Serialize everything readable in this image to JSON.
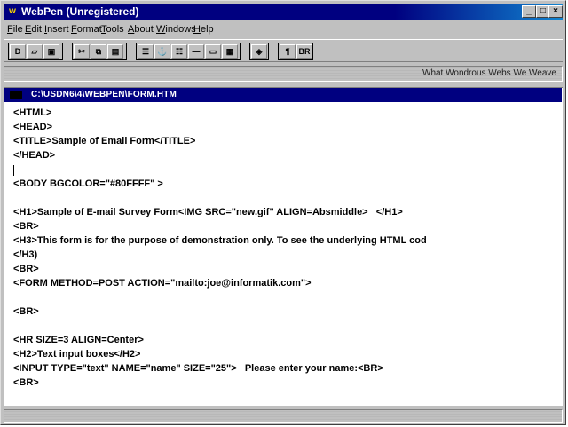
{
  "window": {
    "title": "WebPen  (Unregistered)",
    "controls": [
      "_",
      "□",
      "×"
    ]
  },
  "menu": [
    {
      "label": "File",
      "accel": "F",
      "rest": "ile"
    },
    {
      "label": "Edit",
      "accel": "E",
      "rest": "dit"
    },
    {
      "label": "Insert",
      "accel": "I",
      "rest": "nsert"
    },
    {
      "label": "Format",
      "accel": "F",
      "rest": "ormat",
      "pre": ""
    },
    {
      "label": "Tools",
      "accel": "T",
      "rest": "ools"
    },
    {
      "label": "About",
      "accel": "A",
      "rest": "bout"
    },
    {
      "label": "Windows",
      "accel": "W",
      "rest": "indows"
    },
    {
      "label": "Help",
      "accel": "H",
      "rest": "elp"
    }
  ],
  "toolbar": {
    "buttons": [
      {
        "name": "new-file-icon",
        "glyph": "D"
      },
      {
        "name": "open-file-icon",
        "glyph": "▱"
      },
      {
        "name": "save-file-icon",
        "glyph": "▣"
      },
      {
        "name": "cut-icon",
        "glyph": "✂"
      },
      {
        "name": "copy-icon",
        "glyph": "⧉"
      },
      {
        "name": "paste-icon",
        "glyph": "▤"
      },
      {
        "name": "align-icon",
        "glyph": "☰"
      },
      {
        "name": "anchor-icon",
        "glyph": "⚓"
      },
      {
        "name": "list-icon",
        "glyph": "☷"
      },
      {
        "name": "horizontal-rule-icon",
        "glyph": "—"
      },
      {
        "name": "table-icon",
        "glyph": "▭"
      },
      {
        "name": "form-icon",
        "glyph": "▦"
      },
      {
        "name": "image-icon",
        "glyph": "◈"
      },
      {
        "name": "paragraph-icon",
        "glyph": "¶"
      },
      {
        "name": "break-icon",
        "glyph": "BR"
      }
    ]
  },
  "slogan": "What Wondrous Webs We Weave",
  "document": {
    "path": "C:\\USDN6\\4\\WEBPEN\\FORM.HTM",
    "lines": [
      "<HTML>",
      "<HEAD>",
      "<TITLE>Sample of Email Form</TITLE>",
      "</HEAD>",
      "",
      "<BODY BGCOLOR=\"#80FFFF\" >",
      "",
      "<H1>Sample of E-mail Survey Form<IMG SRC=\"new.gif\" ALIGN=Absmiddle>   </H1>",
      "<BR>",
      "<H3>This form is for the purpose of demonstration only. To see the underlying HTML cod",
      "</H3)",
      "<BR>",
      "<FORM METHOD=POST ACTION=\"mailto:joe@informatik.com\">",
      "",
      "<BR>",
      "",
      "<HR SIZE=3 ALIGN=Center>",
      "<H2>Text input boxes</H2>",
      "<INPUT TYPE=\"text\" NAME=\"name\" SIZE=\"25\">   Please enter your name:<BR>",
      "<BR>"
    ]
  }
}
